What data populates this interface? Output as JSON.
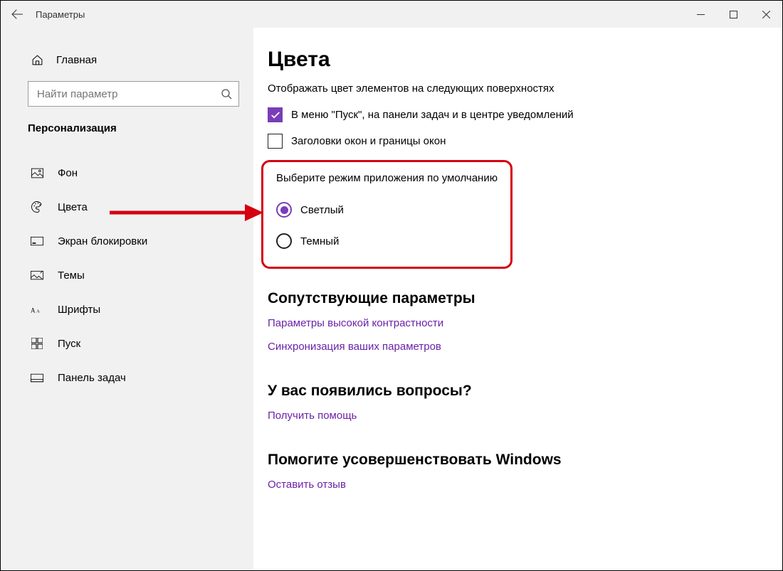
{
  "window": {
    "title": "Параметры"
  },
  "sidebar": {
    "home": "Главная",
    "searchPlaceholder": "Найти параметр",
    "category": "Персонализация",
    "items": [
      {
        "label": "Фон"
      },
      {
        "label": "Цвета"
      },
      {
        "label": "Экран блокировки"
      },
      {
        "label": "Темы"
      },
      {
        "label": "Шрифты"
      },
      {
        "label": "Пуск"
      },
      {
        "label": "Панель задач"
      }
    ]
  },
  "content": {
    "title": "Цвета",
    "surfacesSubtitle": "Отображать цвет элементов на следующих поверхностях",
    "checkStart": "В меню \"Пуск\", на панели задач и в центре уведомлений",
    "checkTitleBars": "Заголовки окон и границы окон",
    "appMode": {
      "header": "Выберите режим приложения по умолчанию",
      "light": "Светлый",
      "dark": "Темный"
    },
    "related": {
      "header": "Сопутствующие параметры",
      "linkHighContrast": "Параметры высокой контрастности",
      "linkSync": "Синхронизация ваших параметров"
    },
    "questions": {
      "header": "У вас появились вопросы?",
      "linkHelp": "Получить помощь"
    },
    "improve": {
      "header": "Помогите усовершенствовать Windows",
      "linkFeedback": "Оставить отзыв"
    }
  }
}
